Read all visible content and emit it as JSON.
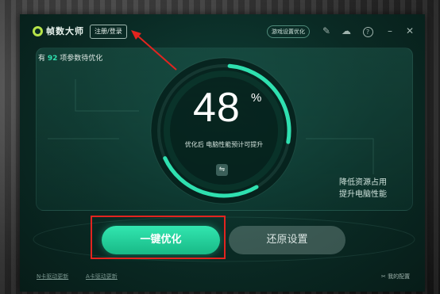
{
  "titlebar": {
    "app_title": "帧数大师",
    "login_label": "注册/登录",
    "game_settings_label": "游戏设置优化",
    "icons": [
      "edit-icon",
      "cloud-icon",
      "help-icon",
      "minimize-icon",
      "close-icon"
    ]
  },
  "panel": {
    "pending_prefix": "有",
    "pending_count": "92",
    "pending_suffix": "项参数待优化",
    "side_line1": "降低资源占用",
    "side_line2": "提升电脑性能"
  },
  "gauge": {
    "percent": "48",
    "percent_sign": "%",
    "description": "优化后 电脑性能预计可提升",
    "fill_fraction": 0.48
  },
  "actions": {
    "optimize_label": "一键优化",
    "restore_label": "还原设置"
  },
  "footer": {
    "n_driver": "N卡驱动更新",
    "a_driver": "A卡驱动更新",
    "my_config": "我的配置"
  },
  "colors": {
    "accent": "#2fe0b0",
    "annotation": "#e3241f"
  }
}
